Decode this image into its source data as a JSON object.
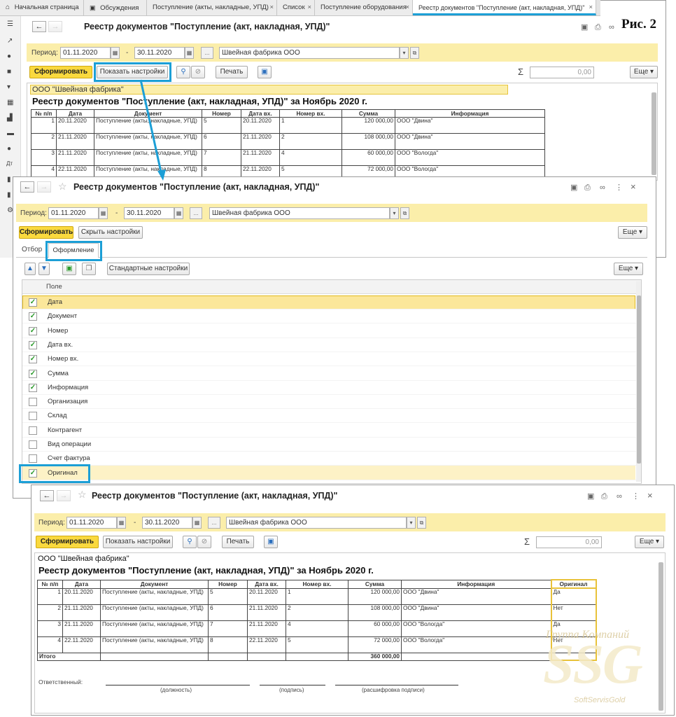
{
  "fig_label": "Рис. 2",
  "tabs": [
    {
      "label": "Начальная страница",
      "icon": "home-icon"
    },
    {
      "label": "Обсуждения",
      "icon": "chat-icon"
    },
    {
      "label": "Поступление (акты, накладные, УПД)",
      "close": "×"
    },
    {
      "label": "Список",
      "close": "×"
    },
    {
      "label": "Поступление оборудования",
      "close": "×"
    },
    {
      "label": "Реестр документов \"Поступление (акт, накладная, УПД)\"",
      "close": "×"
    }
  ],
  "windows": [
    {
      "title": "Реестр документов \"Поступление (акт, накладная, УПД)\"",
      "period_label": "Период:",
      "date_from": "01.11.2020",
      "date_to": "30.11.2020",
      "dash": "-",
      "dots": "...",
      "org": "Швейная фабрика ООО",
      "generate_label": "Сформировать",
      "settings_label": "Показать настройки",
      "print_label": "Печать",
      "sum_symbol": "Σ",
      "sum_value": "0,00",
      "more_label": "Еще ▾"
    },
    {
      "title": "Реестр документов \"Поступление (акт, накладная, УПД)\"",
      "period_label": "Период:",
      "date_from": "01.11.2020",
      "date_to": "30.11.2020",
      "dash": "-",
      "dots": "...",
      "org": "Швейная фабрика ООО",
      "generate_label": "Сформировать",
      "settings_label": "Скрыть настройки",
      "more_label": "Еще ▾",
      "subtab_filter": "Отбор",
      "subtab_format": "Оформление",
      "std_settings_label": "Стандартные настройки",
      "more2_label": "Еще ▾",
      "field_header": "Поле",
      "fields": [
        {
          "name": "Дата",
          "checked": true,
          "mark": "✓"
        },
        {
          "name": "Документ",
          "checked": true,
          "mark": "✓"
        },
        {
          "name": "Номер",
          "checked": true,
          "mark": "✓"
        },
        {
          "name": "Дата вх.",
          "checked": true,
          "mark": "✓"
        },
        {
          "name": "Номер вх.",
          "checked": true,
          "mark": "✓"
        },
        {
          "name": "Сумма",
          "checked": true,
          "mark": "✓"
        },
        {
          "name": "Информация",
          "checked": true,
          "mark": "✓"
        },
        {
          "name": "Организация",
          "checked": false,
          "mark": ""
        },
        {
          "name": "Склад",
          "checked": false,
          "mark": ""
        },
        {
          "name": "Контрагент",
          "checked": false,
          "mark": ""
        },
        {
          "name": "Вид операции",
          "checked": false,
          "mark": ""
        },
        {
          "name": "Счет фактура",
          "checked": false,
          "mark": ""
        },
        {
          "name": "Оригинал",
          "checked": true,
          "mark": "✓"
        }
      ]
    },
    {
      "title": "Реестр документов \"Поступление (акт, накладная, УПД)\"",
      "period_label": "Период:",
      "date_from": "01.11.2020",
      "date_to": "30.11.2020",
      "dash": "-",
      "dots": "...",
      "org": "Швейная фабрика ООО",
      "generate_label": "Сформировать",
      "settings_label": "Показать настройки",
      "print_label": "Печать",
      "sum_symbol": "Σ",
      "sum_value": "0,00",
      "more_label": "Еще ▾"
    }
  ],
  "report": {
    "company": "ООО \"Швейная фабрика\"",
    "heading": "Реестр документов \"Поступление (акт, накладная, УПД)\" за Ноябрь 2020 г.",
    "columns": [
      "№ п/п",
      "Дата",
      "Документ",
      "Номер",
      "Дата вх.",
      "Номер вх.",
      "Сумма",
      "Информация"
    ],
    "column_original": "Оригинал",
    "rows": [
      {
        "n": "1",
        "date": "20.11.2020",
        "doc": "Поступление (акты, накладные, УПД)",
        "num": "5",
        "in_date": "20.11.2020",
        "in_num": "1",
        "sum": "120 000,00",
        "info": "ООО \"Двина\"",
        "orig": "Да"
      },
      {
        "n": "2",
        "date": "21.11.2020",
        "doc": "Поступление (акты, накладные, УПД)",
        "num": "6",
        "in_date": "21.11.2020",
        "in_num": "2",
        "sum": "108 000,00",
        "info": "ООО \"Двина\"",
        "orig": "Нет"
      },
      {
        "n": "3",
        "date": "21.11.2020",
        "doc": "Поступление (акты, накладные, УПД)",
        "num": "7",
        "in_date": "21.11.2020",
        "in_num": "4",
        "sum": "60 000,00",
        "info": "ООО \"Вологда\"",
        "orig": "Да"
      },
      {
        "n": "4",
        "date": "22.11.2020",
        "doc": "Поступление (акты, накладные, УПД)",
        "num": "8",
        "in_date": "22.11.2020",
        "in_num": "5",
        "sum": "72 000,00",
        "info": "ООО \"Вологда\"",
        "orig": "Нет"
      }
    ],
    "total_label": "Итого",
    "total_sum": "360 000,00",
    "responsible_label": "Ответственный:",
    "sig_position": "(должность)",
    "sig_signature": "(подпись)",
    "sig_decode": "(расшифровка подписи)"
  },
  "watermark": {
    "line1": "Группа Компаний",
    "logo": "SSG",
    "line2": "SoftServisGold"
  },
  "colors": {
    "highlight": "#1c9fd6",
    "yellow_bar": "#fbeeaa",
    "primary_button": "#fad93e",
    "original_col": "#e8c23a"
  }
}
